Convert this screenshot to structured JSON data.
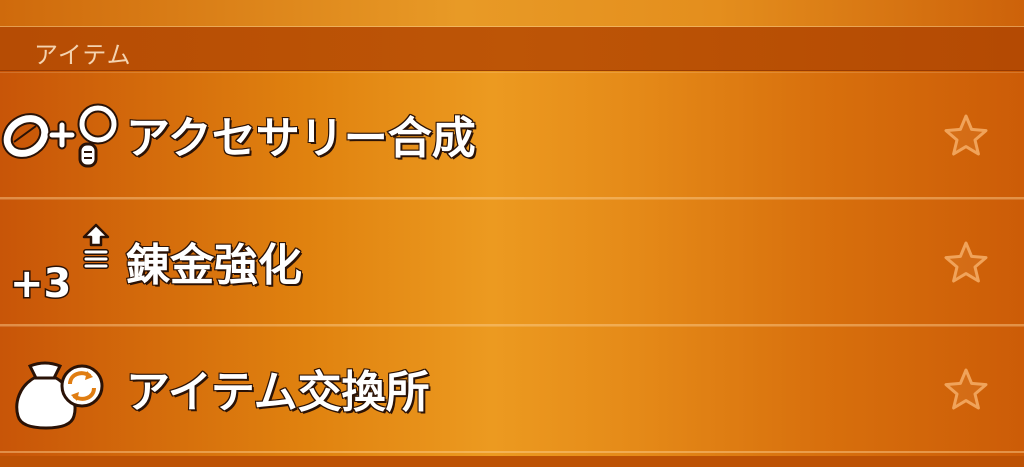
{
  "section": {
    "title": "アイテム"
  },
  "menu": {
    "items": [
      {
        "label": "アクセサリー合成",
        "icon": "accessory-synthesis-icon",
        "favorite": false
      },
      {
        "label": "錬金強化",
        "icon": "alchemy-upgrade-icon",
        "icon_text": "+3",
        "favorite": false
      },
      {
        "label": "アイテム交換所",
        "icon": "item-exchange-bag-icon",
        "favorite": false
      }
    ]
  },
  "colors": {
    "header_background": "#b94f05",
    "header_text": "#f4d3b0",
    "row_gradient_light": "#ec9a20",
    "row_gradient_dark": "#c85508",
    "label_text": "#ffffff",
    "label_outline": "#2a1206",
    "star_outline": "#f0a35a"
  }
}
